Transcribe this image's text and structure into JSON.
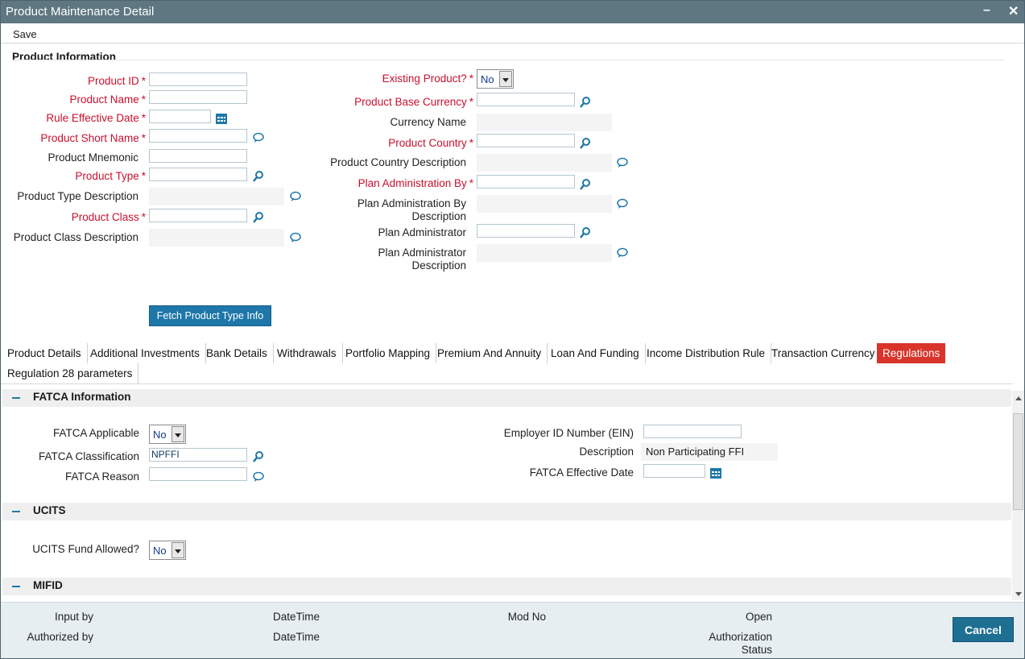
{
  "window": {
    "title": "Product Maintenance Detail",
    "minimize": "–",
    "close": "✕"
  },
  "menu": {
    "save": "Save"
  },
  "product_info": {
    "section_title": "Product Information",
    "product_id": {
      "label": "Product ID",
      "value": ""
    },
    "product_name": {
      "label": "Product Name",
      "value": ""
    },
    "rule_effective_date": {
      "label": "Rule Effective Date",
      "value": ""
    },
    "product_short_name": {
      "label": "Product Short Name",
      "value": ""
    },
    "product_mnemonic": {
      "label": "Product Mnemonic",
      "value": ""
    },
    "product_type": {
      "label": "Product Type",
      "value": ""
    },
    "product_type_description": {
      "label": "Product Type Description",
      "value": ""
    },
    "product_class": {
      "label": "Product Class",
      "value": ""
    },
    "product_class_description": {
      "label": "Product Class Description",
      "value": ""
    },
    "existing_product": {
      "label": "Existing Product?",
      "value": "No"
    },
    "product_base_currency": {
      "label": "Product Base Currency",
      "value": ""
    },
    "currency_name": {
      "label": "Currency Name",
      "value": ""
    },
    "product_country": {
      "label": "Product Country",
      "value": ""
    },
    "product_country_description": {
      "label": "Product Country Description",
      "value": ""
    },
    "plan_administration_by": {
      "label": "Plan Administration By",
      "value": ""
    },
    "plan_administration_by_description": {
      "label_line1": "Plan Administration By",
      "label_line2": "Description",
      "value": ""
    },
    "plan_administrator": {
      "label": "Plan Administrator",
      "value": ""
    },
    "plan_administrator_description": {
      "label_line1": "Plan Administrator",
      "label_line2": "Description",
      "value": ""
    },
    "fetch_button": "Fetch Product Type Info",
    "required_mark": "*"
  },
  "tabs": [
    {
      "label": "Product Details"
    },
    {
      "label": "Additional Investments"
    },
    {
      "label": "Bank Details"
    },
    {
      "label": "Withdrawals"
    },
    {
      "label": "Portfolio Mapping"
    },
    {
      "label": "Premium And Annuity"
    },
    {
      "label": "Loan And Funding"
    },
    {
      "label": "Income Distribution Rule"
    },
    {
      "label": "Transaction Currency"
    },
    {
      "label": "Regulations"
    },
    {
      "label": "Regulation 28 parameters"
    }
  ],
  "active_tab": "Regulations",
  "fatca": {
    "title": "FATCA Information",
    "applicable": {
      "label": "FATCA Applicable",
      "value": "No"
    },
    "classification": {
      "label": "FATCA Classification",
      "value": "NPFFI"
    },
    "reason": {
      "label": "FATCA Reason",
      "value": ""
    },
    "ein": {
      "label": "Employer ID Number (EIN)",
      "value": ""
    },
    "description": {
      "label": "Description",
      "value": "Non Participating FFI"
    },
    "effective_date": {
      "label": "FATCA Effective Date",
      "value": ""
    }
  },
  "ucits": {
    "title": "UCITS",
    "fund_allowed": {
      "label": "UCITS Fund Allowed?",
      "value": "No"
    }
  },
  "mifid": {
    "title": "MIFID"
  },
  "footer": {
    "input_by": "Input by",
    "authorized_by": "Authorized by",
    "datetime1": "DateTime",
    "datetime2": "DateTime",
    "mod_no": "Mod No",
    "open": "Open",
    "authorization_status_1": "Authorization",
    "authorization_status_2": "Status",
    "cancel": "Cancel"
  },
  "colors": {
    "titlebar": "#5f7781",
    "accent": "#1e77a8",
    "active_tab": "#d9342b",
    "required": "#c8102e",
    "footer": "#e6eef2"
  }
}
